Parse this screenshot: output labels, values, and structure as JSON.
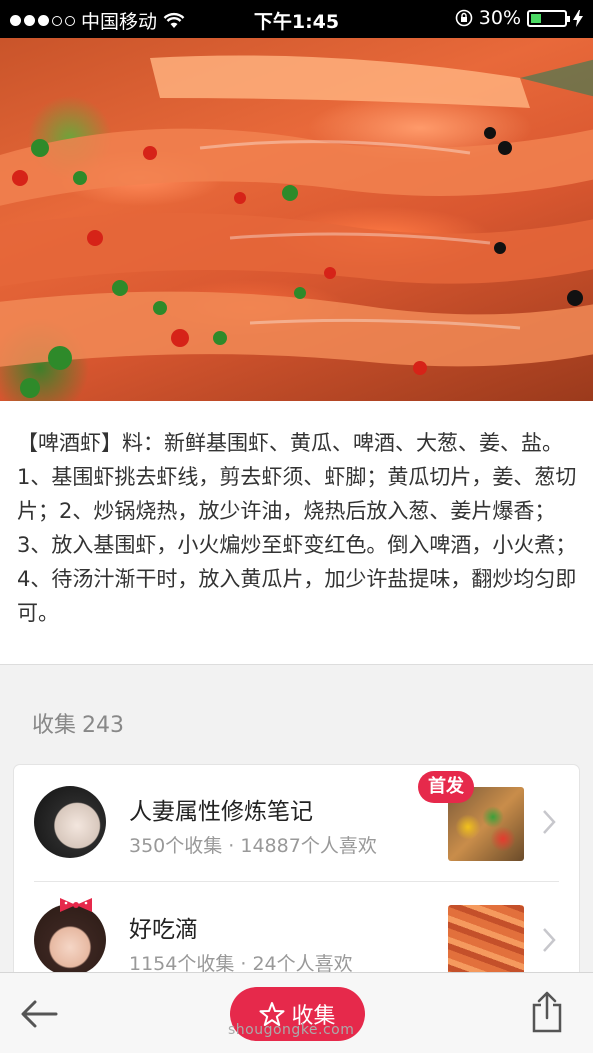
{
  "status_bar": {
    "carrier": "中国移动",
    "time": "下午1:45",
    "battery_percent": "30%",
    "battery_level": 0.3
  },
  "hero": {
    "image": "grilled-shrimp-photo"
  },
  "description": "【啤酒虾】料：新鲜基围虾、黄瓜、啤酒、大葱、姜、盐。1、基围虾挑去虾线，剪去虾须、虾脚；黄瓜切片，姜、葱切片；2、炒锅烧热，放少许油，烧热后放入葱、姜片爆香；3、放入基围虾，小火煸炒至虾变红色。倒入啤酒，小火煮；4、待汤汁渐干时，放入黄瓜片，加少许盐提味，翻炒均匀即可。",
  "collections": {
    "label": "收集",
    "count": "243",
    "items": [
      {
        "name": "人妻属性修炼笔记",
        "stats": "350个收集 · 14887个人喜欢",
        "badge": "首发"
      },
      {
        "name": "好吃滴",
        "stats": "1154个收集 · 24个人喜欢",
        "badge": ""
      }
    ]
  },
  "bottom_bar": {
    "collect_label": "收集"
  },
  "watermark": "shougongke.com",
  "colors": {
    "accent": "#e6294b",
    "battery_green": "#4cd964"
  },
  "icons": {
    "back": "arrow-left-icon",
    "collect": "star-icon",
    "share": "share-icon",
    "chevron": "chevron-right-icon",
    "wifi": "wifi-icon",
    "lock": "orientation-lock-icon",
    "charging": "bolt-icon"
  }
}
